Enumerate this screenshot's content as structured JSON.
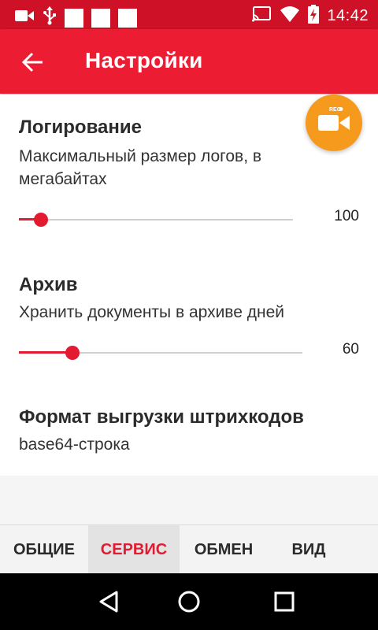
{
  "status_bar": {
    "time": "14:42",
    "left_icons": [
      "video-camera-icon",
      "usb-icon",
      "notification-square-icon",
      "notification-square-icon",
      "notification-square-icon"
    ],
    "right_icons": [
      "cast-icon",
      "wifi-icon",
      "battery-charging-icon"
    ]
  },
  "app_bar": {
    "title": "Настройки",
    "back_icon": "arrow-left-icon"
  },
  "settings": {
    "logging": {
      "title": "Логирование",
      "description": "Максимальный размер логов, в мегабайтах",
      "value": "100",
      "fraction": 0.08
    },
    "archive": {
      "title": "Архив",
      "description": "Хранить документы в архиве дней",
      "value": "60",
      "fraction": 0.19
    },
    "barcode_format": {
      "title": "Формат выгрузки штрихкодов",
      "value": "base64-строка"
    }
  },
  "rec_button": {
    "label": "REC",
    "icon": "video-record-icon",
    "color": "#f59a1d"
  },
  "tabs": [
    {
      "label": "ОБЩИЕ",
      "active": false
    },
    {
      "label": "СЕРВИС",
      "active": true
    },
    {
      "label": "ОБМЕН",
      "active": false
    },
    {
      "label": "ВИД",
      "active": false
    }
  ],
  "colors": {
    "accent": "#e21b30",
    "app_bar": "#ec1c33",
    "status_bar": "#ce1126"
  }
}
